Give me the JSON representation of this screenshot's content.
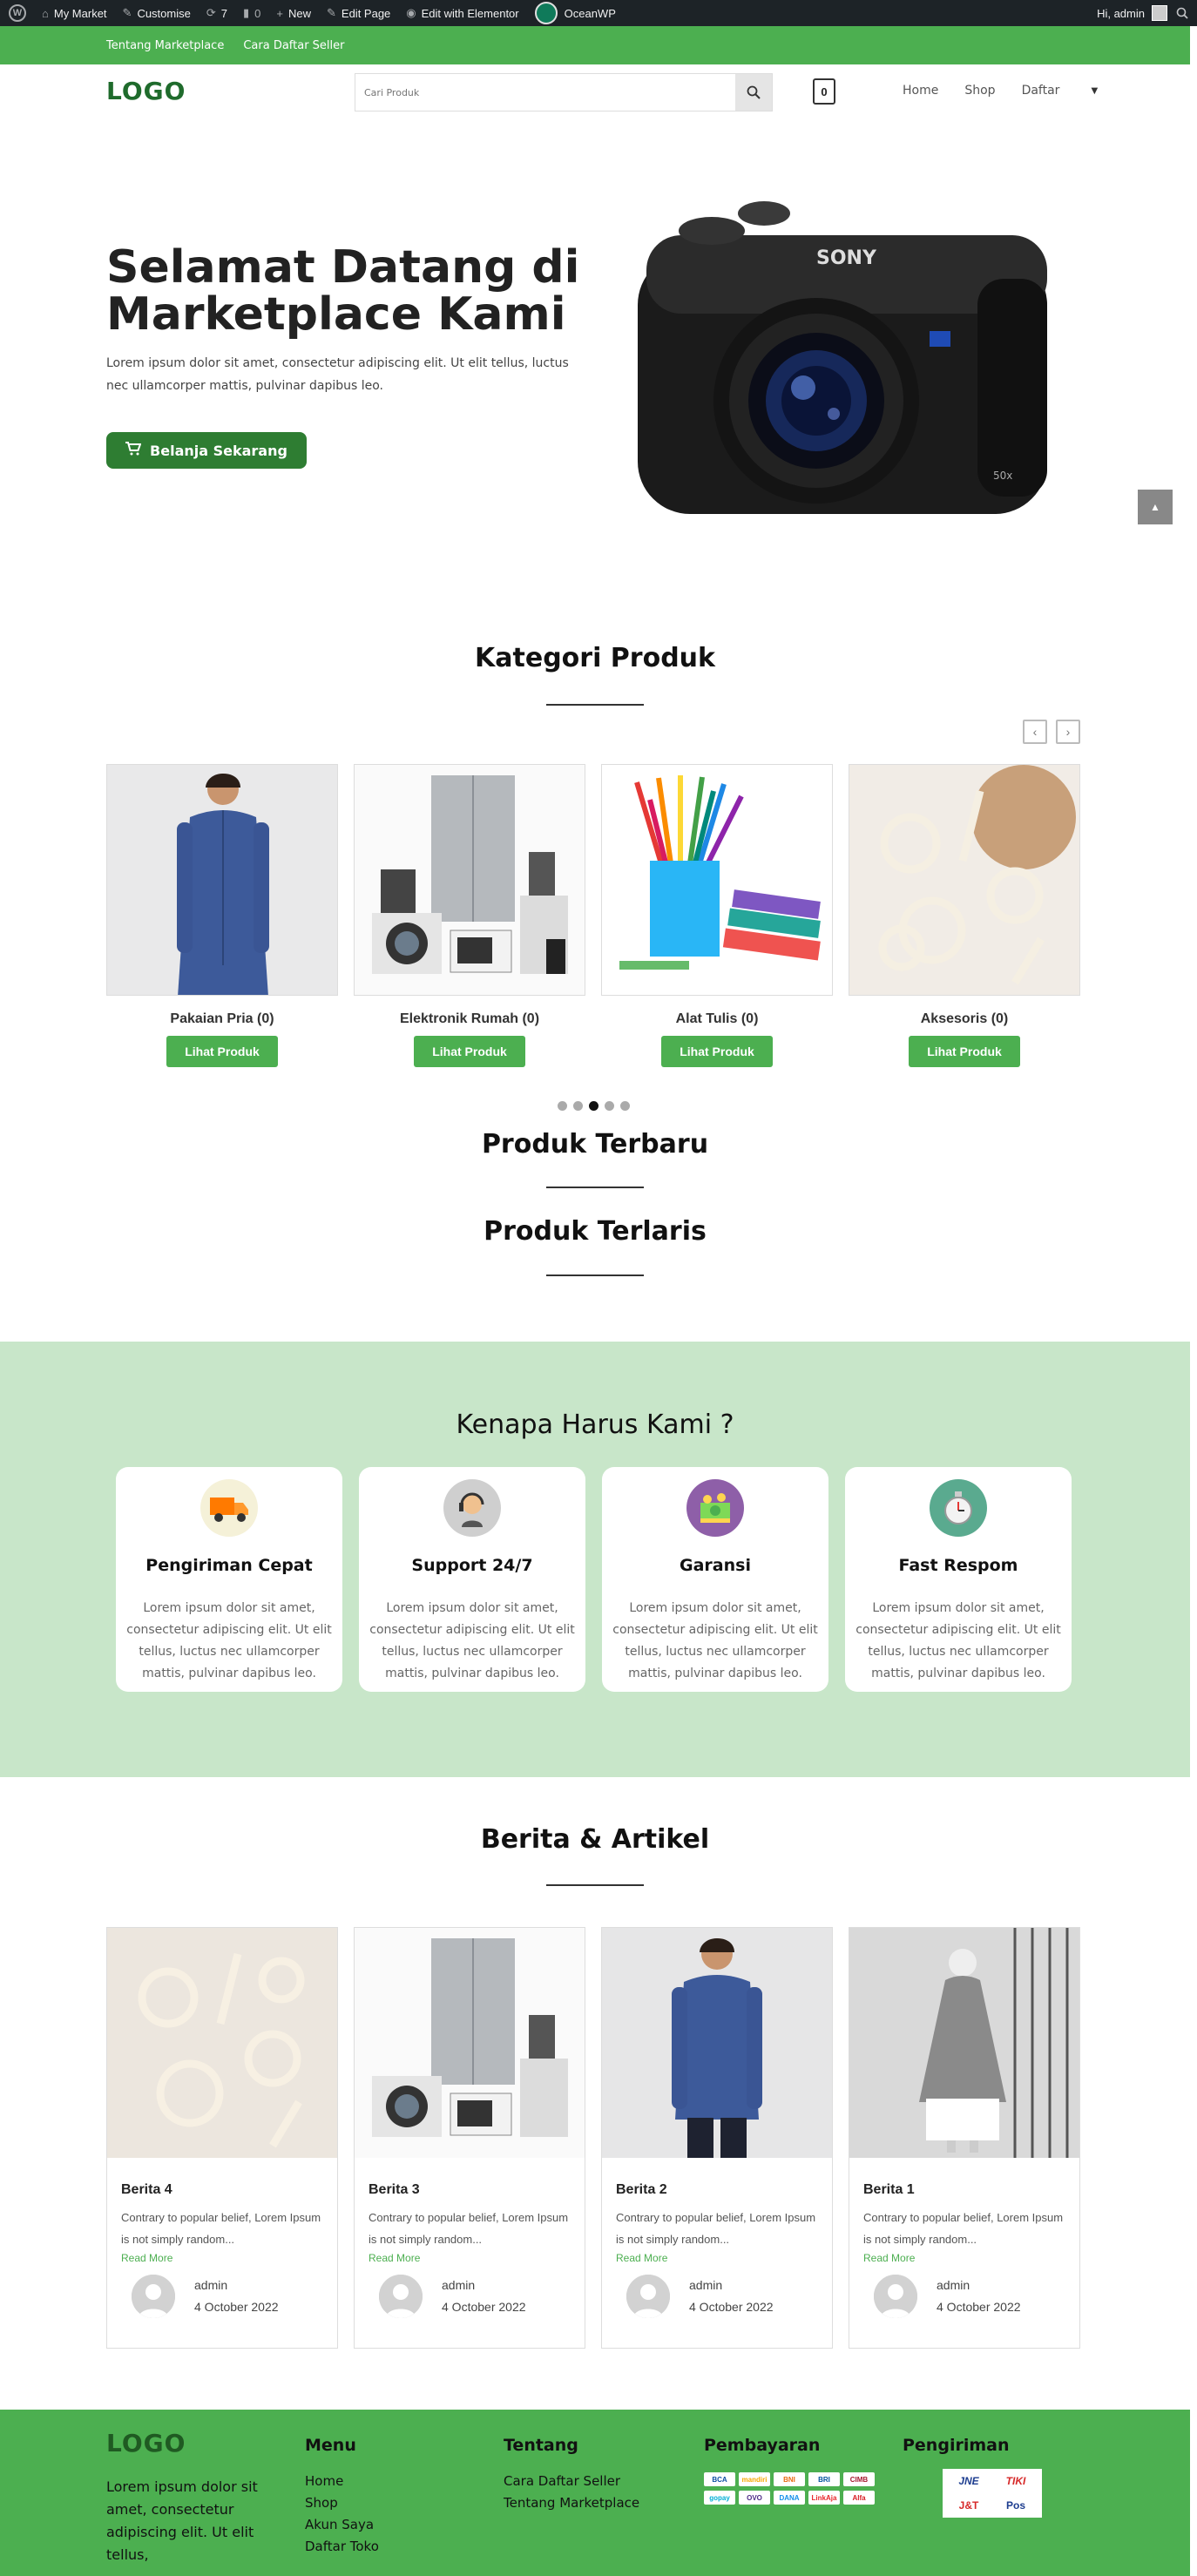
{
  "adminbar": {
    "site": "My Market",
    "customise": "Customise",
    "updates": "7",
    "comments": "0",
    "new": "New",
    "edit_page": "Edit Page",
    "elementor": "Edit with Elementor",
    "oceanwp": "OceanWP",
    "greeting": "Hi, admin"
  },
  "topbar": {
    "links": [
      "Tentang Marketplace",
      "Cara Daftar Seller"
    ]
  },
  "header": {
    "logo": "LOGO",
    "search_placeholder": "Cari Produk",
    "cart_count": "0",
    "nav": [
      "Home",
      "Shop",
      "Daftar"
    ]
  },
  "hero": {
    "title": "Selamat Datang di Marketplace Kami",
    "text": "Lorem ipsum dolor sit amet, consectetur adipiscing elit. Ut elit tellus, luctus nec ullamcorper mattis, pulvinar dapibus leo.",
    "button": "Belanja Sekarang"
  },
  "categories": {
    "title": "Kategori Produk",
    "items": [
      {
        "name": "Pakaian Pria (0)",
        "button": "Lihat Produk"
      },
      {
        "name": "Elektronik Rumah (0)",
        "button": "Lihat Produk"
      },
      {
        "name": "Alat Tulis (0)",
        "button": "Lihat Produk"
      },
      {
        "name": "Aksesoris (0)",
        "button": "Lihat Produk"
      }
    ]
  },
  "latest": {
    "title": "Produk Terbaru"
  },
  "bestseller": {
    "title": "Produk Terlaris"
  },
  "why": {
    "title": "Kenapa Harus Kami ?",
    "items": [
      {
        "title": "Pengiriman Cepat",
        "text": "Lorem ipsum dolor sit amet, consectetur adipiscing elit. Ut elit tellus, luctus nec ullamcorper mattis, pulvinar dapibus leo.",
        "icon": "truck-icon"
      },
      {
        "title": "Support 24/7",
        "text": "Lorem ipsum dolor sit amet, consectetur adipiscing elit. Ut elit tellus, luctus nec ullamcorper mattis, pulvinar dapibus leo.",
        "icon": "support-icon"
      },
      {
        "title": "Garansi",
        "text": "Lorem ipsum dolor sit amet, consectetur adipiscing elit. Ut elit tellus, luctus nec ullamcorper mattis, pulvinar dapibus leo.",
        "icon": "money-icon"
      },
      {
        "title": "Fast Respom",
        "text": "Lorem ipsum dolor sit amet, consectetur adipiscing elit. Ut elit tellus, luctus nec ullamcorper mattis, pulvinar dapibus leo.",
        "icon": "stopwatch-icon"
      }
    ]
  },
  "news": {
    "title": "Berita & Artikel",
    "posts": [
      {
        "title": "Berita 4",
        "excerpt": "Contrary to popular belief, Lorem Ipsum is not simply random...",
        "more": "Read More",
        "author": "admin",
        "date": "4 October 2022"
      },
      {
        "title": "Berita 3",
        "excerpt": "Contrary to popular belief, Lorem Ipsum is not simply random...",
        "more": "Read More",
        "author": "admin",
        "date": "4 October 2022"
      },
      {
        "title": "Berita 2",
        "excerpt": "Contrary to popular belief, Lorem Ipsum is not simply random...",
        "more": "Read More",
        "author": "admin",
        "date": "4 October 2022"
      },
      {
        "title": "Berita 1",
        "excerpt": "Contrary to popular belief, Lorem Ipsum is not simply random...",
        "more": "Read More",
        "author": "admin",
        "date": "4 October 2022"
      }
    ]
  },
  "footer": {
    "logo": "LOGO",
    "text": "Lorem ipsum dolor sit amet, consectetur adipiscing elit. Ut elit tellus,",
    "menu": {
      "title": "Menu",
      "links": [
        "Home",
        "Shop",
        "Akun Saya",
        "Daftar Toko"
      ]
    },
    "about": {
      "title": "Tentang",
      "links": [
        "Cara Daftar Seller",
        "Tentang Marketplace"
      ]
    },
    "payment": {
      "title": "Pembayaran",
      "logos": [
        "BCA",
        "mandiri",
        "BNI",
        "BRI",
        "CIMB",
        "gopay",
        "OVO",
        "DANA",
        "LinkAja",
        "Alfa"
      ]
    },
    "shipping": {
      "title": "Pengiriman",
      "logos": [
        "JNE",
        "TIKI",
        "J&T",
        "Pos"
      ]
    }
  }
}
